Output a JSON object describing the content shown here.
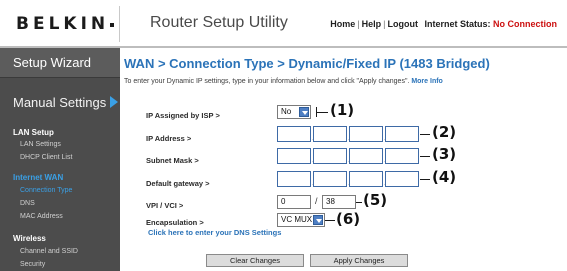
{
  "header": {
    "logo": "BELKIN",
    "app_title": "Router Setup Utility",
    "links": {
      "home": "Home",
      "help": "Help",
      "logout": "Logout"
    },
    "status_label": "Internet Status:",
    "status_value": "No Connection"
  },
  "sidebar": {
    "setup_wizard": "Setup Wizard",
    "manual_settings": "Manual Settings",
    "sections": [
      {
        "heading": "LAN Setup",
        "items": [
          "LAN Settings",
          "DHCP Client List"
        ]
      },
      {
        "heading": "Internet WAN",
        "items": [
          "Connection Type",
          "DNS",
          "MAC Address"
        ]
      },
      {
        "heading": "Wireless",
        "items": [
          "Channel and SSID",
          "Security"
        ]
      }
    ],
    "active_item": "Connection Type"
  },
  "main": {
    "title": "WAN > Connection Type > Dynamic/Fixed IP (1483 Bridged)",
    "intro": "To enter your Dynamic IP settings, type in your information below and click \"Apply changes\".",
    "more_info": "More Info",
    "fields": {
      "ip_assigned": {
        "label": "IP Assigned by ISP >",
        "value": "No",
        "callout": "(1)"
      },
      "ip_address": {
        "label": "IP Address >",
        "callout": "(2)"
      },
      "subnet_mask": {
        "label": "Subnet Mask >",
        "callout": "(3)"
      },
      "default_gateway": {
        "label": "Default gateway >",
        "callout": "(4)"
      },
      "vpi_vci": {
        "label": "VPI / VCI >",
        "vpi": "0",
        "separator": "/",
        "vci": "38",
        "callout": "(5)"
      },
      "encapsulation": {
        "label": "Encapsulation >",
        "value": "VC MUX",
        "callout": "(6)"
      }
    },
    "dns_link": "Click here to enter your DNS Settings",
    "buttons": {
      "clear": "Clear Changes",
      "apply": "Apply Changes"
    }
  },
  "colors": {
    "accent": "#2b73b8",
    "sidebar_bg": "#4c4c4c",
    "active_nav": "#3aa0e6",
    "status_error": "#cc1010"
  },
  "icons": {
    "manual_settings_arrow": "triangle-right-icon",
    "dropdown": "chevron-down-icon"
  }
}
